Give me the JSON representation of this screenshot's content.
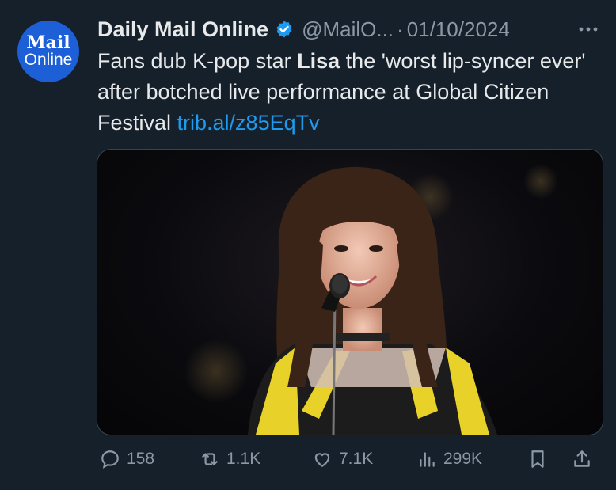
{
  "account": {
    "avatar_top": "Mail",
    "avatar_bottom": "Online",
    "name": "Daily Mail Online",
    "handle": "@MailO...",
    "separator": "·",
    "date": "01/10/2024"
  },
  "tweet": {
    "text_1": "Fans dub K-pop star ",
    "text_bold": "Lisa",
    "text_2": " the 'worst lip-syncer ever' after botched live performance at Global Citizen Festival ",
    "link": "trib.al/z85EqTv"
  },
  "media": {
    "description_icon": "photo-of-performer-with-microphone"
  },
  "stats": {
    "replies": "158",
    "reposts": "1.1K",
    "likes": "7.1K",
    "views": "299K"
  },
  "icons": {
    "verified": "verified-badge-icon",
    "more": "more-icon",
    "reply": "reply-icon",
    "repost": "repost-icon",
    "like": "heart-icon",
    "views": "views-icon",
    "bookmark": "bookmark-icon",
    "share": "share-icon"
  },
  "colors": {
    "background": "#15202b",
    "link": "#1d9bf0",
    "muted": "#8b98a5",
    "avatar": "#1d5fd6"
  }
}
